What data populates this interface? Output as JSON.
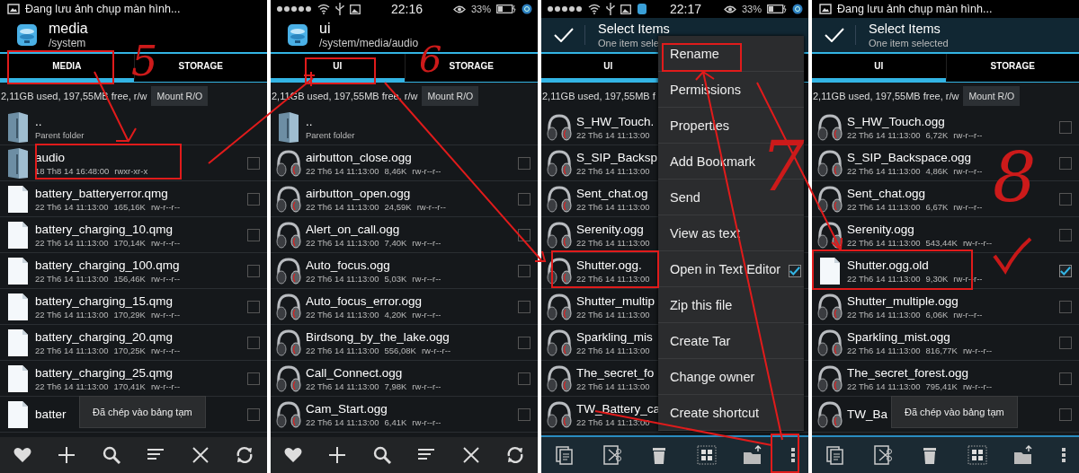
{
  "panels": [
    {
      "status": {
        "kind": "notification",
        "text": "Đang lưu ảnh chụp màn hình..."
      },
      "header": {
        "kind": "location",
        "title": "media",
        "subtitle": "/system"
      },
      "tabs": [
        {
          "label": "MEDIA",
          "selected": true
        },
        {
          "label": "STORAGE",
          "selected": false
        }
      ],
      "storage": {
        "text": "2,11GB used, 197,55MB free, r/w",
        "button": "Mount R/O"
      },
      "rows": [
        {
          "kind": "parent",
          "name": "..",
          "note": "Parent folder"
        },
        {
          "kind": "folder",
          "name": "audio",
          "date": "18 Th8 14 16:48:00",
          "perms": "rwxr-xr-x",
          "checked": false
        },
        {
          "kind": "file",
          "name": "battery_batteryerror.qmg",
          "date": "22 Th6 14 11:13:00",
          "size": "165,16K",
          "perms": "rw-r--r--",
          "checked": false
        },
        {
          "kind": "file",
          "name": "battery_charging_10.qmg",
          "date": "22 Th6 14 11:13:00",
          "size": "170,14K",
          "perms": "rw-r--r--",
          "checked": false
        },
        {
          "kind": "file",
          "name": "battery_charging_100.qmg",
          "date": "22 Th6 14 11:13:00",
          "size": "156,46K",
          "perms": "rw-r--r--",
          "checked": false
        },
        {
          "kind": "file",
          "name": "battery_charging_15.qmg",
          "date": "22 Th6 14 11:13:00",
          "size": "170,29K",
          "perms": "rw-r--r--",
          "checked": false
        },
        {
          "kind": "file",
          "name": "battery_charging_20.qmg",
          "date": "22 Th6 14 11:13:00",
          "size": "170,25K",
          "perms": "rw-r--r--",
          "checked": false
        },
        {
          "kind": "file",
          "name": "battery_charging_25.qmg",
          "date": "22 Th6 14 11:13:00",
          "size": "170,41K",
          "perms": "rw-r--r--",
          "checked": false
        },
        {
          "kind": "file",
          "name": "batter",
          "checked": false
        }
      ],
      "toast": "Đã chép vào bảng tạm",
      "toolbar": {
        "kind": "browse"
      }
    },
    {
      "status": {
        "kind": "system",
        "time": "22:16",
        "battery": "33%"
      },
      "header": {
        "kind": "location",
        "title": "ui",
        "subtitle": "/system/media/audio"
      },
      "tabs": [
        {
          "label": "UI",
          "selected": true
        },
        {
          "label": "STORAGE",
          "selected": false
        }
      ],
      "storage": {
        "text": "2,11GB used, 197,55MB free, r/w",
        "button": "Mount R/O"
      },
      "rows": [
        {
          "kind": "parent",
          "name": "..",
          "note": "Parent folder"
        },
        {
          "kind": "audio",
          "name": "airbutton_close.ogg",
          "date": "22 Th6 14 11:13:00",
          "size": "8,46K",
          "perms": "rw-r--r--",
          "checked": false
        },
        {
          "kind": "audio",
          "name": "airbutton_open.ogg",
          "date": "22 Th6 14 11:13:00",
          "size": "24,59K",
          "perms": "rw-r--r--",
          "checked": false
        },
        {
          "kind": "audio",
          "name": "Alert_on_call.ogg",
          "date": "22 Th6 14 11:13:00",
          "size": "7,40K",
          "perms": "rw-r--r--",
          "checked": false
        },
        {
          "kind": "audio",
          "name": "Auto_focus.ogg",
          "date": "22 Th6 14 11:13:00",
          "size": "5,03K",
          "perms": "rw-r--r--",
          "checked": false
        },
        {
          "kind": "audio",
          "name": "Auto_focus_error.ogg",
          "date": "22 Th6 14 11:13:00",
          "size": "4,20K",
          "perms": "rw-r--r--",
          "checked": false
        },
        {
          "kind": "audio",
          "name": "Birdsong_by_the_lake.ogg",
          "date": "22 Th6 14 11:13:00",
          "size": "556,08K",
          "perms": "rw-r--r--",
          "checked": false
        },
        {
          "kind": "audio",
          "name": "Call_Connect.ogg",
          "date": "22 Th6 14 11:13:00",
          "size": "7,98K",
          "perms": "rw-r--r--",
          "checked": false
        },
        {
          "kind": "audio",
          "name": "Cam_Start.ogg",
          "date": "22 Th6 14 11:13:00",
          "size": "6,41K",
          "perms": "rw-r--r--",
          "checked": false
        }
      ],
      "toolbar": {
        "kind": "browse"
      }
    },
    {
      "status": {
        "kind": "system",
        "time": "22:17",
        "battery": "33%",
        "app_icon": true
      },
      "header": {
        "kind": "selection",
        "title": "Select Items",
        "subtitle": "One item sele"
      },
      "tabs": [
        {
          "label": "UI",
          "selected": true
        }
      ],
      "storage": {
        "text": "2,11GB used, 197,55MB f"
      },
      "rows": [
        {
          "kind": "audio",
          "name": "S_HW_Touch.",
          "date": "22 Th6 14 11:13:00"
        },
        {
          "kind": "audio",
          "name": "S_SIP_Backsp",
          "date": "22 Th6 14 11:13:00"
        },
        {
          "kind": "audio",
          "name": "Sent_chat.og",
          "date": "22 Th6 14 11:13:00"
        },
        {
          "kind": "audio",
          "name": "Serenity.ogg",
          "date": "22 Th6 14 11:13:00"
        },
        {
          "kind": "audio",
          "name": "Shutter.ogg.",
          "date": "22 Th6 14 11:13:00",
          "checked": true
        },
        {
          "kind": "audio",
          "name": "Shutter_multip",
          "date": "22 Th6 14 11:13:00"
        },
        {
          "kind": "audio",
          "name": "Sparkling_mis",
          "date": "22 Th6 14 11:13:00"
        },
        {
          "kind": "audio",
          "name": "The_secret_fo",
          "date": "22 Th6 14 11:13:00"
        },
        {
          "kind": "audio",
          "name": "TW_Battery_ca",
          "date": "22 Th6 14 11:13:00"
        }
      ],
      "menu": [
        "Rename",
        "Permissions",
        "Properties",
        "Add Bookmark",
        "Send",
        "View as text",
        "Open in Text Editor",
        "Zip this file",
        "Create Tar",
        "Change owner",
        "Create shortcut"
      ],
      "toolbar": {
        "kind": "selection"
      }
    },
    {
      "status": {
        "kind": "notification",
        "text": "Đang lưu ảnh chụp màn hình..."
      },
      "header": {
        "kind": "selection",
        "title": "Select Items",
        "subtitle": "One item selected"
      },
      "tabs": [
        {
          "label": "UI",
          "selected": true
        },
        {
          "label": "STORAGE",
          "selected": false
        }
      ],
      "storage": {
        "text": "2,11GB used, 197,55MB free, r/w",
        "button": "Mount R/O"
      },
      "rows": [
        {
          "kind": "audio",
          "name": "S_HW_Touch.ogg",
          "date": "22 Th6 14 11:13:00",
          "size": "6,72K",
          "perms": "rw-r--r--",
          "checked": false
        },
        {
          "kind": "audio",
          "name": "S_SIP_Backspace.ogg",
          "date": "22 Th6 14 11:13:00",
          "size": "4,86K",
          "perms": "rw-r--r--",
          "checked": false
        },
        {
          "kind": "audio",
          "name": "Sent_chat.ogg",
          "date": "22 Th6 14 11:13:00",
          "size": "6,67K",
          "perms": "rw-r--r--",
          "checked": false
        },
        {
          "kind": "audio",
          "name": "Serenity.ogg",
          "date": "22 Th6 14 11:13:00",
          "size": "543,44K",
          "perms": "rw-r--r--",
          "checked": false
        },
        {
          "kind": "file",
          "name": "Shutter.ogg.old",
          "date": "22 Th6 14 11:13:00",
          "size": "9,30K",
          "perms": "rw-r--r--",
          "checked": true
        },
        {
          "kind": "audio",
          "name": "Shutter_multiple.ogg",
          "date": "22 Th6 14 11:13:00",
          "size": "6,06K",
          "perms": "rw-r--r--",
          "checked": false
        },
        {
          "kind": "audio",
          "name": "Sparkling_mist.ogg",
          "date": "22 Th6 14 11:13:00",
          "size": "816,77K",
          "perms": "rw-r--r--",
          "checked": false
        },
        {
          "kind": "audio",
          "name": "The_secret_forest.ogg",
          "date": "22 Th6 14 11:13:00",
          "size": "795,41K",
          "perms": "rw-r--r--",
          "checked": false
        },
        {
          "kind": "audio",
          "name": "TW_Ba",
          "checked": false
        }
      ],
      "toast": "Đã chép vào bảng tạm",
      "toolbar": {
        "kind": "selection"
      }
    }
  ],
  "annotations": {
    "numbers": [
      "5",
      "6",
      "7",
      "8"
    ]
  }
}
